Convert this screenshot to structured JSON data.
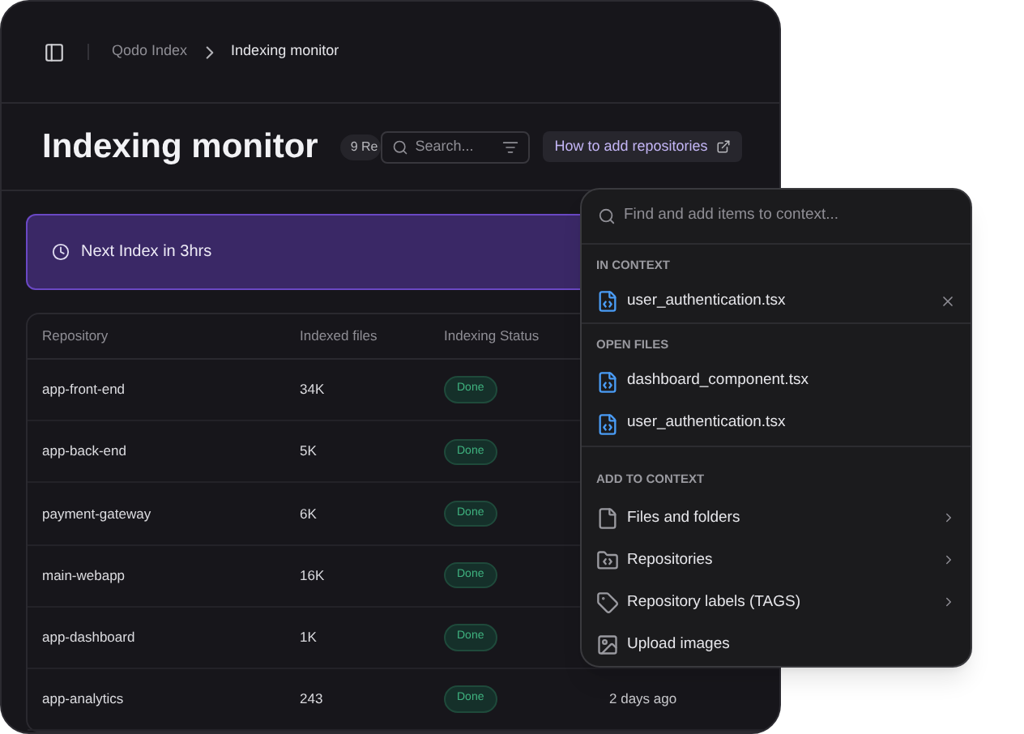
{
  "breadcrumb": [
    {
      "label": "Qodo Index",
      "selected": false
    },
    {
      "label": "Indexing monitor",
      "selected": true
    }
  ],
  "header": {
    "title": "Indexing monitor",
    "count_badge": "9 Re",
    "search": {
      "placeholder": "Search..."
    },
    "help_link": "How to add repositories"
  },
  "banner": {
    "text": "Next Index in 3hrs"
  },
  "table": {
    "columns": [
      "Repository",
      "Indexed files",
      "Indexing Status"
    ],
    "rows": [
      {
        "repository": "app-front-end",
        "indexed_files": "34K",
        "status": "Done"
      },
      {
        "repository": "app-back-end",
        "indexed_files": "5K",
        "status": "Done"
      },
      {
        "repository": "payment-gateway",
        "indexed_files": "6K",
        "status": "Done"
      },
      {
        "repository": "main-webapp",
        "indexed_files": "16K",
        "status": "Done"
      },
      {
        "repository": "app-dashboard",
        "indexed_files": "1K",
        "status": "Done"
      },
      {
        "repository": "app-analytics",
        "indexed_files": "243",
        "status": "Done",
        "column_4": "2 days ago"
      }
    ]
  },
  "context_menu": {
    "search": {
      "placeholder": "Find and add items to context..."
    },
    "sections": [
      {
        "title": "IN CONTEXT",
        "items": [
          {
            "kind": "file",
            "label": "user_authentication.tsx",
            "removable": true
          }
        ]
      },
      {
        "title": "OPEN FILES",
        "items": [
          {
            "kind": "file",
            "label": "dashboard_component.tsx",
            "removable": false
          },
          {
            "kind": "file",
            "label": "user_authentication.tsx",
            "removable": false
          }
        ]
      },
      {
        "title": "ADD TO CONTEXT",
        "items": [
          {
            "kind": "files",
            "label": "Files and folders",
            "submenu": true
          },
          {
            "kind": "folder",
            "label": "Repositories",
            "submenu": true
          },
          {
            "kind": "tag",
            "label": "Repository labels (TAGS)",
            "submenu": true
          },
          {
            "kind": "image",
            "label": "Upload images",
            "submenu": false
          }
        ]
      }
    ]
  }
}
